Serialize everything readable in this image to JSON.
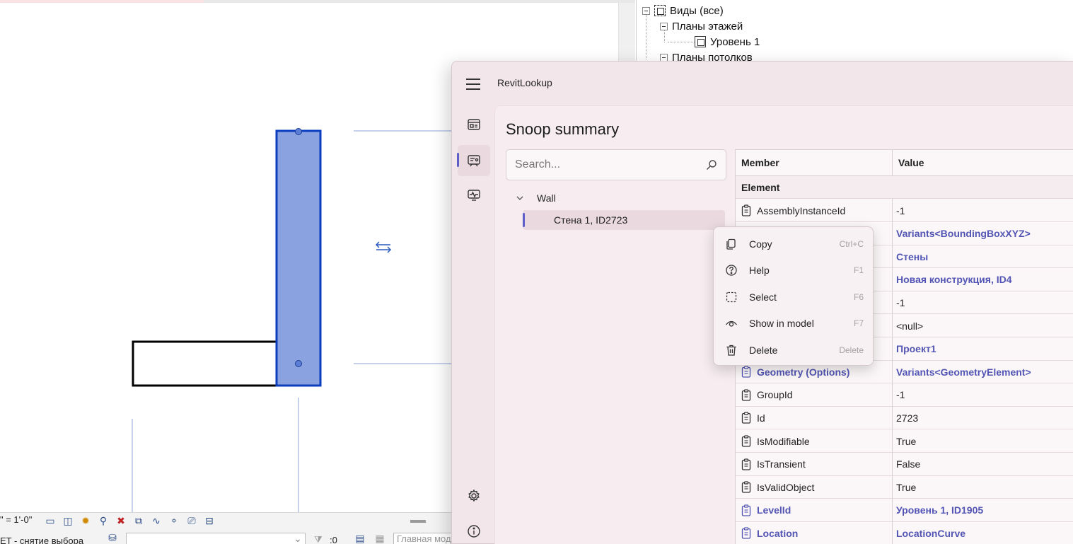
{
  "colors": {
    "accent": "#5b5fc7",
    "link": "#5255b3",
    "wall_fill": "#8aa3e0",
    "wall_stroke": "#0b3ebf"
  },
  "browser": {
    "views_all": "Виды (все)",
    "floor_plans": "Планы этажей",
    "level1": "Уровень 1",
    "ceiling_plans": "Планы потолков"
  },
  "statusbar": {
    "scale": "\" = 1'-0\"",
    "status_text": "ET - снятие выбора",
    "count": ":0",
    "view_name": "Главная модель"
  },
  "lookup": {
    "app_title": "RevitLookup",
    "page_title": "Snoop summary",
    "search": {
      "placeholder": "Search...",
      "value": ""
    },
    "tree": {
      "root": "Wall",
      "child": "Стена 1, ID2723"
    },
    "grid": {
      "col_member": "Member",
      "col_value": "Value",
      "group": "Element",
      "rows": [
        {
          "member": "AssemblyInstanceId",
          "value": "-1",
          "link": false
        },
        {
          "member": "",
          "value": "Variants<BoundingBoxXYZ>",
          "link": true
        },
        {
          "member": "",
          "value": "Стены",
          "link": true
        },
        {
          "member": "",
          "value": "Новая конструкция, ID4",
          "link": true
        },
        {
          "member": "",
          "value": "-1",
          "link": false
        },
        {
          "member": "",
          "value": "<null>",
          "link": false
        },
        {
          "member": "",
          "value": "Проект1",
          "link": true
        },
        {
          "member": "Geometry (Options)",
          "value": "Variants<GeometryElement>",
          "link": true
        },
        {
          "member": "GroupId",
          "value": "-1",
          "link": false
        },
        {
          "member": "Id",
          "value": "2723",
          "link": false
        },
        {
          "member": "IsModifiable",
          "value": "True",
          "link": false
        },
        {
          "member": "IsTransient",
          "value": "False",
          "link": false
        },
        {
          "member": "IsValidObject",
          "value": "True",
          "link": false
        },
        {
          "member": "LevelId",
          "value": "Уровень 1, ID1905",
          "link": true
        },
        {
          "member": "Location",
          "value": "LocationCurve",
          "link": true
        }
      ]
    }
  },
  "context_menu": {
    "items": [
      {
        "label": "Copy",
        "shortcut": "Ctrl+C",
        "icon": "copy-icon"
      },
      {
        "label": "Help",
        "shortcut": "F1",
        "icon": "help-icon"
      },
      {
        "label": "Select",
        "shortcut": "F6",
        "icon": "select-icon"
      },
      {
        "label": "Show in model",
        "shortcut": "F7",
        "icon": "eye-icon"
      },
      {
        "label": "Delete",
        "shortcut": "Delete",
        "icon": "trash-icon"
      }
    ]
  }
}
